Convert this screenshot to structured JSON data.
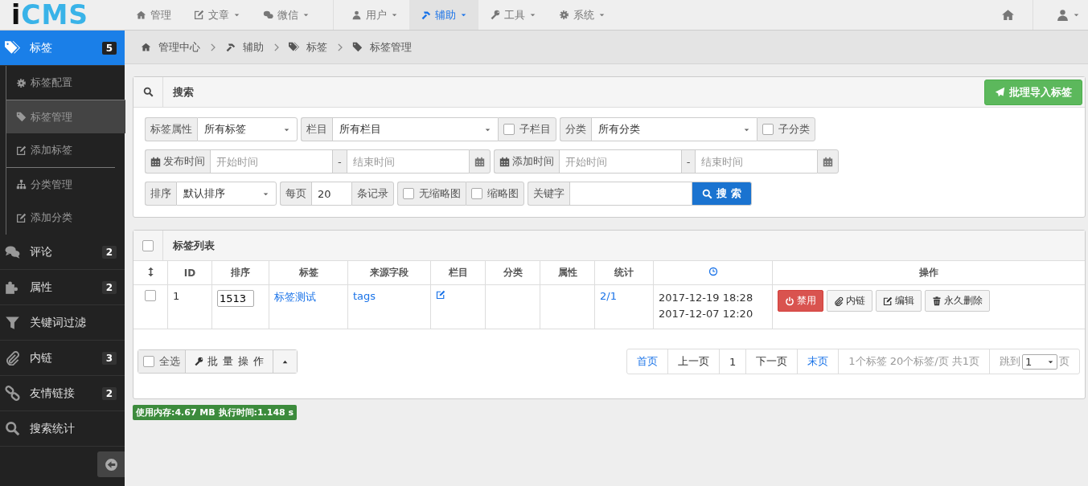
{
  "logo": {
    "text": "iCMS"
  },
  "nav": [
    {
      "label": "管理",
      "dropdown": false,
      "selected": false
    },
    {
      "label": "文章",
      "dropdown": true,
      "selected": false
    },
    {
      "label": "微信",
      "dropdown": true,
      "selected": false
    },
    {
      "label": "用户",
      "dropdown": true,
      "selected": false
    },
    {
      "label": "辅助",
      "dropdown": true,
      "selected": true
    },
    {
      "label": "工具",
      "dropdown": true,
      "selected": false
    },
    {
      "label": "系统",
      "dropdown": true,
      "selected": false
    }
  ],
  "sidebar": {
    "items": [
      {
        "label": "标签",
        "badge": "5",
        "selected": true,
        "children": [
          {
            "label": "标签配置",
            "selected": false
          },
          {
            "label": "标签管理",
            "selected": true
          },
          {
            "label": "添加标签",
            "selected": false
          },
          {
            "label": "分类管理",
            "selected": false
          },
          {
            "label": "添加分类",
            "selected": false
          }
        ]
      },
      {
        "label": "评论",
        "badge": "2",
        "selected": false
      },
      {
        "label": "属性",
        "badge": "2",
        "selected": false
      },
      {
        "label": "关键词过滤",
        "selected": false
      },
      {
        "label": "内链",
        "badge": "3",
        "selected": false
      },
      {
        "label": "友情链接",
        "badge": "2",
        "selected": false
      },
      {
        "label": "搜索统计",
        "selected": false
      }
    ]
  },
  "breadcrumb": [
    "管理中心",
    "辅助",
    "标签",
    "标签管理"
  ],
  "search_panel": {
    "title": "搜索",
    "import_button": "批理导入标签",
    "rows": [
      {
        "groups": [
          {
            "parts": [
              {
                "kind": "addon",
                "label": "标签属性"
              },
              {
                "kind": "select",
                "value": "所有标签"
              }
            ]
          },
          {
            "parts": [
              {
                "kind": "addon",
                "label": "栏目"
              },
              {
                "kind": "select",
                "value": "所有栏目"
              },
              {
                "kind": "checkbox",
                "label": "子栏目",
                "checked": false
              }
            ]
          },
          {
            "parts": [
              {
                "kind": "addon",
                "label": "分类"
              },
              {
                "kind": "select",
                "value": "所有分类"
              },
              {
                "kind": "checkbox",
                "label": "子分类",
                "checked": false
              }
            ]
          }
        ]
      },
      {
        "groups": [
          {
            "parts": [
              {
                "kind": "date-addon",
                "label": "发布时间"
              },
              {
                "kind": "date",
                "placeholder": "开始时间"
              },
              {
                "kind": "addon",
                "label": "-"
              },
              {
                "kind": "date",
                "placeholder": "结束时间"
              },
              {
                "kind": "calendar"
              }
            ]
          },
          {
            "parts": [
              {
                "kind": "date-addon",
                "label": "添加时间"
              },
              {
                "kind": "date",
                "placeholder": "开始时间"
              },
              {
                "kind": "addon",
                "label": "-"
              },
              {
                "kind": "date",
                "placeholder": "结束时间"
              },
              {
                "kind": "calendar"
              }
            ]
          }
        ]
      },
      {
        "groups": [
          {
            "parts": [
              {
                "kind": "addon",
                "label": "排序"
              },
              {
                "kind": "select",
                "value": "默认排序"
              }
            ]
          },
          {
            "parts": [
              {
                "kind": "addon",
                "label": "每页"
              },
              {
                "kind": "input",
                "value": "20"
              },
              {
                "kind": "addon",
                "label": "条记录"
              }
            ]
          },
          {
            "parts": [
              {
                "kind": "checkbox",
                "label": "无缩略图",
                "checked": false
              },
              {
                "kind": "checkbox",
                "label": "缩略图",
                "checked": false
              }
            ]
          },
          {
            "parts": [
              {
                "kind": "addon",
                "label": "关键字"
              },
              {
                "kind": "input"
              },
              {
                "kind": "button",
                "label": "搜 索"
              }
            ]
          }
        ]
      }
    ]
  },
  "table": {
    "title": "标签列表",
    "header_checked": false,
    "columns": [
      {
        "kind": "updown"
      },
      {
        "kind": "text",
        "label": "ID"
      },
      {
        "kind": "text",
        "label": "排序"
      },
      {
        "kind": "text",
        "label": "标签"
      },
      {
        "kind": "text",
        "label": "来源字段"
      },
      {
        "kind": "text",
        "label": "栏目"
      },
      {
        "kind": "text",
        "label": "分类"
      },
      {
        "kind": "text",
        "label": "属性"
      },
      {
        "kind": "text",
        "label": "统计"
      },
      {
        "kind": "clock"
      },
      {
        "kind": "text",
        "label": "操作"
      }
    ],
    "rows": [
      {
        "cells": [
          {
            "kind": "checkbox",
            "checked": false
          },
          {
            "kind": "text",
            "text": "1"
          },
          {
            "kind": "input",
            "value": "1513"
          },
          {
            "kind": "link",
            "text": "标签测试"
          },
          {
            "kind": "link",
            "text": "tags"
          },
          {
            "kind": "edit"
          },
          {
            "kind": "empty"
          },
          {
            "kind": "empty"
          },
          {
            "kind": "link",
            "text": "2/1"
          },
          {
            "kind": "lines",
            "lines": [
              "2017-12-19 18:28",
              "2017-12-07 12:20"
            ]
          },
          {
            "kind": "actions",
            "buttons": [
              {
                "label": "禁用",
                "kind": "danger"
              },
              {
                "label": "内链",
                "kind": "default"
              },
              {
                "label": "编辑",
                "kind": "default"
              },
              {
                "label": "永久删除",
                "kind": "default"
              }
            ]
          }
        ]
      }
    ]
  },
  "footer": {
    "select_all": {
      "label": "全选",
      "checked": false
    },
    "batch_button": "批 量 操 作",
    "pagination": [
      {
        "label": "首页",
        "kind": "link"
      },
      {
        "label": "上一页",
        "kind": "text"
      },
      {
        "label": "1",
        "kind": "text"
      },
      {
        "label": "下一页",
        "kind": "text"
      },
      {
        "label": "末页",
        "kind": "link"
      },
      {
        "label": "1个标签 20个标签/页 共1页",
        "kind": "info"
      }
    ],
    "jump": {
      "label": "跳到",
      "value": "1",
      "suffix": "页"
    }
  },
  "status_bar": "使用内存:4.67 MB 执行时间:1.148 s"
}
